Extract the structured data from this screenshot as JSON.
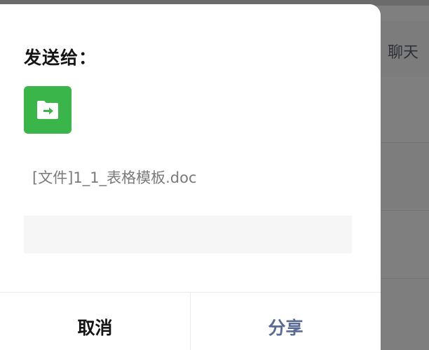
{
  "background": {
    "chat_label": "聊天"
  },
  "dialog": {
    "title": "发送给：",
    "file": {
      "icon": "file-transfer-icon",
      "icon_color": "#39b54a",
      "name": "[文件]1_1_表格模板.doc"
    },
    "message_input": {
      "value": "",
      "placeholder": ""
    },
    "buttons": {
      "cancel_label": "取消",
      "share_label": "分享",
      "share_color": "#576b95"
    }
  }
}
